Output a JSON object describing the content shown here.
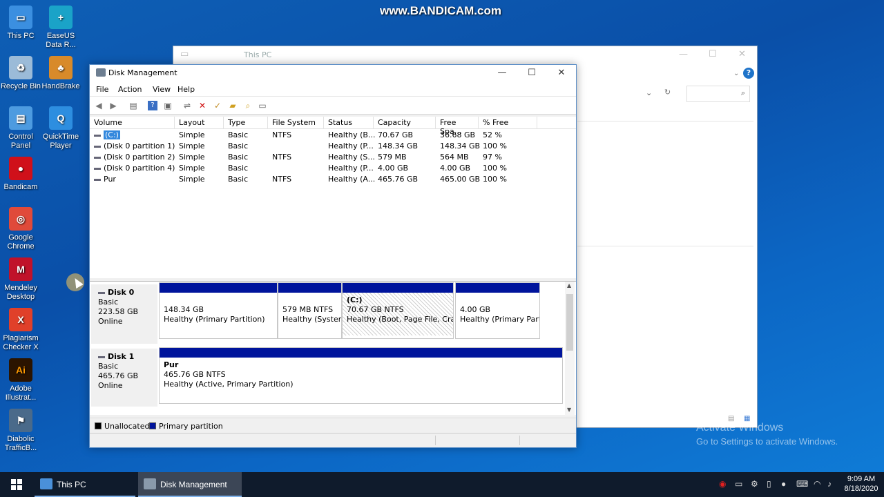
{
  "watermark": "www.BANDICAM.com",
  "desktop_icons": [
    {
      "label": "This PC",
      "icon": "this-pc-icon",
      "color": "#3b8fe0"
    },
    {
      "label": "EaseUS Data R...",
      "icon": "easeus-icon",
      "color": "#1aa3c8"
    },
    {
      "label": "Recycle Bin",
      "icon": "recycle-bin-icon",
      "color": "#9bbbd8"
    },
    {
      "label": "HandBrake",
      "icon": "handbrake-icon",
      "color": "#d88a2a"
    },
    {
      "label": "Control Panel",
      "icon": "control-panel-icon",
      "color": "#4d9be0"
    },
    {
      "label": "QuickTime Player",
      "icon": "quicktime-icon",
      "color": "#2d8ee0"
    },
    {
      "label": "Bandicam",
      "icon": "bandicam-icon",
      "color": "#d0101a"
    },
    {
      "label": "Google Chrome",
      "icon": "chrome-icon",
      "color": "#e04a3a"
    },
    {
      "label": "Mendeley Desktop",
      "icon": "mendeley-icon",
      "color": "#c0122a"
    },
    {
      "label": "Plagiarism Checker X",
      "icon": "plagiarism-checker-icon",
      "color": "#e0402a"
    },
    {
      "label": "Adobe Illustrat...",
      "icon": "illustrator-icon",
      "color": "#2b1400"
    },
    {
      "label": "Diabolic TrafficB...",
      "icon": "diabolic-icon",
      "color": "#4a6a8a"
    }
  ],
  "bg_window": {
    "title": "This PC"
  },
  "dm": {
    "title": "Disk Management",
    "menu": [
      "File",
      "Action",
      "View",
      "Help"
    ],
    "columns": [
      "Volume",
      "Layout",
      "Type",
      "File System",
      "Status",
      "Capacity",
      "Free Spa...",
      "% Free"
    ],
    "volumes": [
      {
        "volume": "(C:)",
        "layout": "Simple",
        "type": "Basic",
        "fs": "NTFS",
        "status": "Healthy (B...",
        "capacity": "70.67 GB",
        "free": "36.68 GB",
        "pct": "52 %"
      },
      {
        "volume": "(Disk 0 partition 1)",
        "layout": "Simple",
        "type": "Basic",
        "fs": "",
        "status": "Healthy (P...",
        "capacity": "148.34 GB",
        "free": "148.34 GB",
        "pct": "100 %"
      },
      {
        "volume": "(Disk 0 partition 2)",
        "layout": "Simple",
        "type": "Basic",
        "fs": "NTFS",
        "status": "Healthy (S...",
        "capacity": "579 MB",
        "free": "564 MB",
        "pct": "97 %"
      },
      {
        "volume": "(Disk 0 partition 4)",
        "layout": "Simple",
        "type": "Basic",
        "fs": "",
        "status": "Healthy (P...",
        "capacity": "4.00 GB",
        "free": "4.00 GB",
        "pct": "100 %"
      },
      {
        "volume": "Pur",
        "layout": "Simple",
        "type": "Basic",
        "fs": "NTFS",
        "status": "Healthy (A...",
        "capacity": "465.76 GB",
        "free": "465.00 GB",
        "pct": "100 %"
      }
    ],
    "disk0": {
      "name": "Disk 0",
      "type": "Basic",
      "size": "223.58 GB",
      "state": "Online",
      "partitions": [
        {
          "l1": "",
          "l2": "148.34 GB",
          "l3": "Healthy (Primary Partition)"
        },
        {
          "l1": "",
          "l2": "579 MB NTFS",
          "l3": "Healthy (System"
        },
        {
          "l1": "(C:)",
          "l2": "70.67 GB NTFS",
          "l3": "Healthy (Boot, Page File, Crash"
        },
        {
          "l1": "",
          "l2": "4.00 GB",
          "l3": "Healthy (Primary Parti"
        }
      ]
    },
    "disk1": {
      "name": "Disk 1",
      "type": "Basic",
      "size": "465.76 GB",
      "state": "Online",
      "partitions": [
        {
          "l1": "Pur",
          "l2": "465.76 GB NTFS",
          "l3": "Healthy (Active, Primary Partition)"
        }
      ]
    },
    "legend": {
      "unallocated": "Unallocated",
      "primary": "Primary partition",
      "unallocated_color": "#000000",
      "primary_color": "#00149c"
    }
  },
  "activation": {
    "line1": "Activate Windows",
    "line2": "Go to Settings to activate Windows."
  },
  "taskbar": {
    "items": [
      {
        "label": "This PC"
      },
      {
        "label": "Disk Management"
      }
    ],
    "time": "9:09 AM",
    "date": "8/18/2020"
  }
}
